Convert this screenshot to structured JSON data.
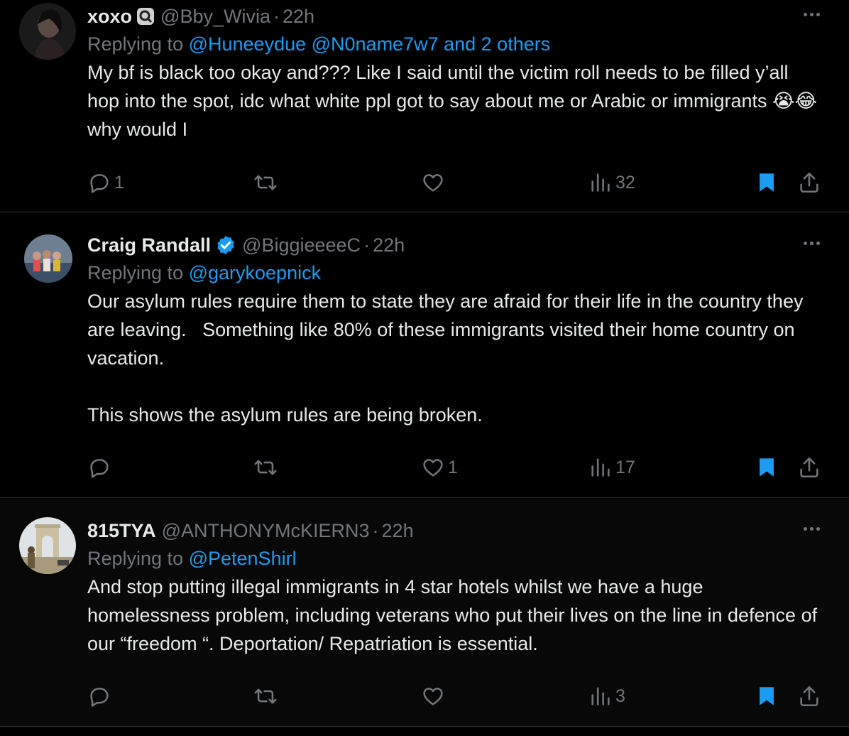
{
  "tweets": [
    {
      "name": "xoxo",
      "handle": "@Bby_Wivia",
      "separator": "·",
      "time": "22h",
      "replying_prefix": "Replying to ",
      "mentions": "@Huneeydue @N0name7w7 and 2 others",
      "text": "My bf is black too okay and??? Like I said until the victim roll needs to be filled y’all hop into the spot, idc what white ppl got to say about me or Arabic or immigrants 😭😂 why would I",
      "replies": "1",
      "reposts": "",
      "likes": "",
      "views": "32",
      "bookmarked": true,
      "name_icon": "magnifier-badge-icon"
    },
    {
      "name": "Craig Randall",
      "handle": "@BiggieeeeC",
      "separator": "·",
      "time": "22h",
      "replying_prefix": "Replying to ",
      "mentions": "@garykoepnick",
      "text": "Our asylum rules require them to state they are afraid for their life in the country they are leaving.   Something like 80% of these immigrants visited their home country on vacation.\n\nThis shows the asylum rules are being broken.",
      "replies": "",
      "reposts": "",
      "likes": "1",
      "views": "17",
      "bookmarked": true,
      "verified": true
    },
    {
      "name": "815TYA",
      "handle": "@ANTHONYMcKIERN3",
      "separator": "·",
      "time": "22h",
      "replying_prefix": "Replying to ",
      "mentions": "@PetenShirl",
      "text": "And stop putting illegal immigrants in 4 star hotels whilst we have a huge homelessness problem, including veterans who put their lives on the line in defence of our “freedom “. Deportation/ Repatriation is essential.",
      "replies": "",
      "reposts": "",
      "likes": "",
      "views": "3",
      "bookmarked": true
    }
  ],
  "colors": {
    "background": "#000000",
    "text": "#e7e9ea",
    "muted": "#71767b",
    "accent": "#1d9bf0",
    "border": "#2f3336"
  }
}
